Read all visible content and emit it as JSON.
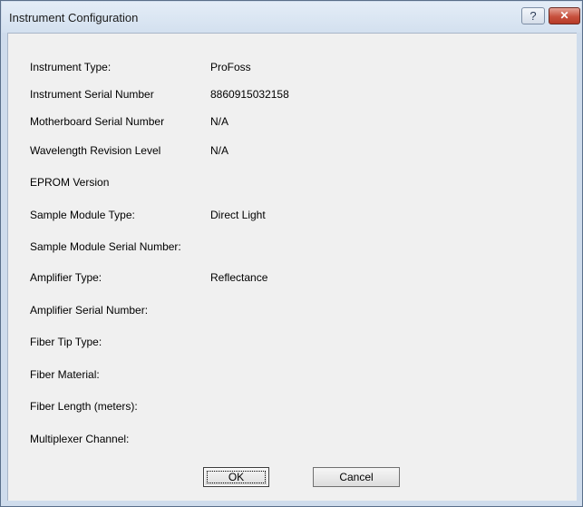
{
  "window": {
    "title": "Instrument Configuration",
    "help_glyph": "?",
    "close_glyph": "✕"
  },
  "fields": [
    {
      "label": "Instrument Type:",
      "value": "ProFoss"
    },
    {
      "label": "Instrument Serial Number",
      "value": "8860915032158"
    },
    {
      "label": "Motherboard Serial Number",
      "value": "N/A"
    },
    {
      "label": "Wavelength Revision Level",
      "value": "N/A"
    },
    {
      "label": "EPROM Version",
      "value": ""
    },
    {
      "label": "Sample Module Type:",
      "value": "Direct Light"
    },
    {
      "label": "Sample Module Serial Number:",
      "value": ""
    },
    {
      "label": "Amplifier Type:",
      "value": "Reflectance"
    },
    {
      "label": "Amplifier Serial Number:",
      "value": ""
    },
    {
      "label": "Fiber Tip Type:",
      "value": ""
    },
    {
      "label": "Fiber Material:",
      "value": ""
    },
    {
      "label": "Fiber Length (meters):",
      "value": ""
    },
    {
      "label": "Multiplexer Channel:",
      "value": ""
    }
  ],
  "buttons": {
    "ok": "OK",
    "cancel": "Cancel"
  },
  "colors": {
    "title_bar": "#d3e0ef",
    "dialog_body": "#f0f0f0",
    "close_button": "#c7503d"
  },
  "icons": {
    "help": "help-icon",
    "close": "close-icon"
  }
}
